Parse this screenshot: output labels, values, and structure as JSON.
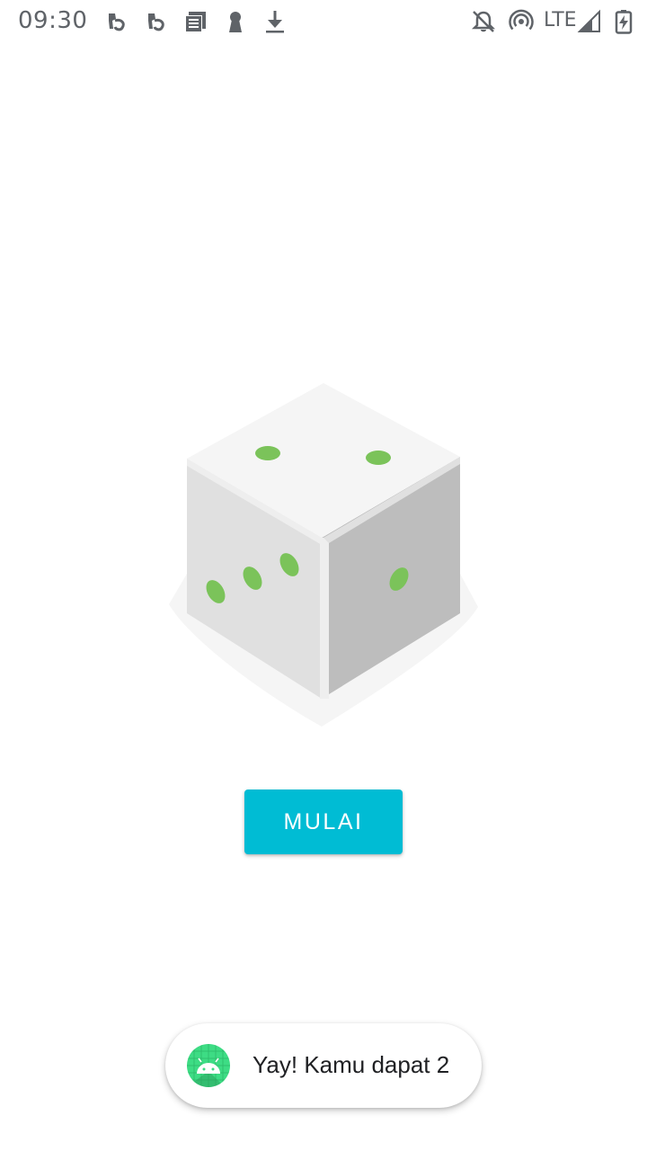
{
  "status_bar": {
    "time": "09:30",
    "network": "LTE",
    "icons": [
      "voicemail-icon",
      "voicemail-icon",
      "news-icon",
      "keyhole-icon",
      "download-icon",
      "notifications-off-icon",
      "hotspot-icon",
      "signal-icon",
      "battery-charging-icon"
    ]
  },
  "main": {
    "dice_icon": "dice-icon",
    "start_button_label": "MULAI"
  },
  "toast": {
    "app_icon": "android-app-icon",
    "message": "Yay! Kamu dapat 2"
  },
  "colors": {
    "button": "#00bcd4",
    "dice_dots": "#7bc35a",
    "status_icons": "#5f6368"
  }
}
